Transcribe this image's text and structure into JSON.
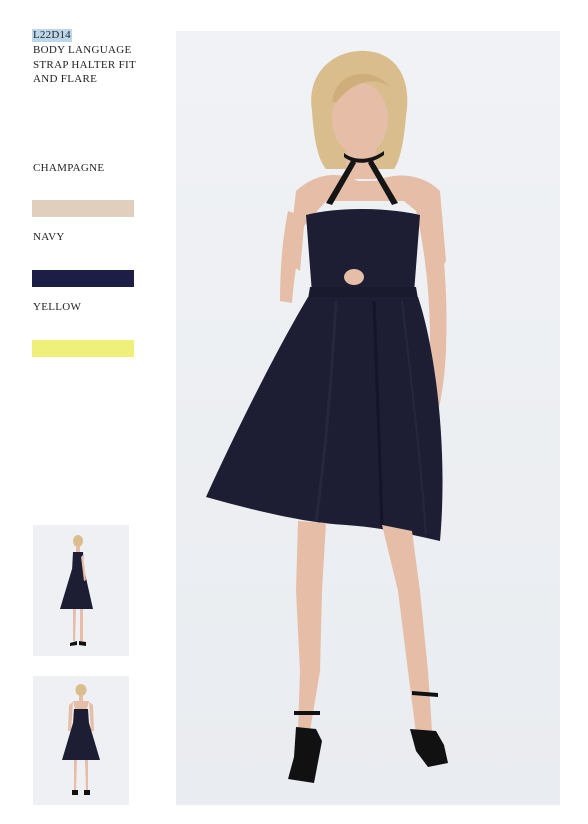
{
  "product": {
    "sku": "L22D14",
    "title": "BODY LANGUAGE STRAP HALTER FIT AND FLARE"
  },
  "colors": [
    {
      "name": "CHAMPAGNE",
      "hex": "#e0cfbc"
    },
    {
      "name": "NAVY",
      "hex": "#1e1d45"
    },
    {
      "name": "YELLOW",
      "hex": "#eef07a"
    }
  ],
  "images": {
    "main": "front-view",
    "thumbnails": [
      "side-view",
      "back-view"
    ]
  },
  "palette": {
    "dress": "#1d1d33",
    "skin": "#e6bea8",
    "hair": "#d9bd8c",
    "backdrop": "#eceef1"
  }
}
